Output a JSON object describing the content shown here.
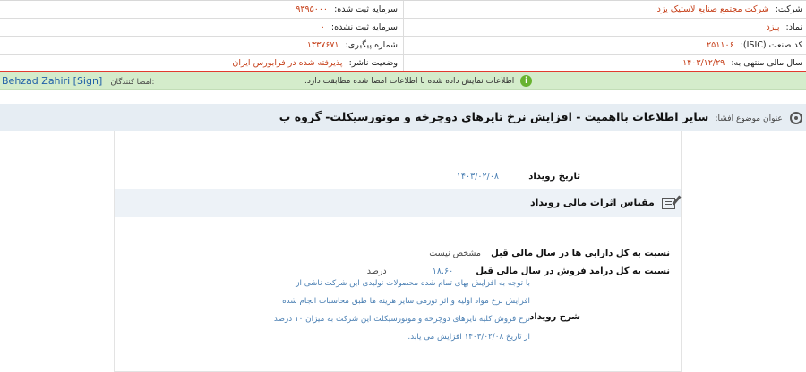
{
  "company_info": {
    "company_label": "شرکت:",
    "company_value": "شرکت مجتمع صنایع لاستیک یزد",
    "symbol_label": "نماد:",
    "symbol_value": "پیزد",
    "isic_label": "کد صنعت (ISIC):",
    "isic_value": "۲۵۱۱۰۶",
    "fiscal_year_label": "سال مالی منتهی به:",
    "fiscal_year_value": "۱۴۰۳/۱۲/۲۹",
    "registered_capital_label": "سرمایه ثبت شده:",
    "registered_capital_value": "۹۳۹۵۰۰۰",
    "unregistered_capital_label": "سرمایه ثبت نشده:",
    "unregistered_capital_value": "۰",
    "tracking_label": "شماره پیگیری:",
    "tracking_value": "۱۳۳۷۶۷۱",
    "publisher_status_label": "وضعیت ناشر:",
    "publisher_status_value": "پذیرفته شده در فرابورس ایران"
  },
  "signers": {
    "label": "امضا کنندگان:",
    "name": "Behzad Zahiri [Sign]",
    "notice": "اطلاعات نمایش داده شده با اطلاعات امضا شده مطابقت دارد."
  },
  "subject": {
    "label": "عنوان موضوع افشا:",
    "title": "سایر اطلاعات بااهمیت - افزایش نرخ تایرهای دوچرخه و موتورسیکلت- گروه ب"
  },
  "event": {
    "date_label": "تاریخ رویداد",
    "date_value": "۱۴۰۳/۰۲/۰۸",
    "section_title": "مقیاس اثرات مالی رویداد",
    "assets_ratio_label": "نسبت به کل دارایی ها در سال مالی قبل",
    "assets_ratio_value": "مشخص نیست",
    "sales_ratio_label": "نسبت به کل درامد فروش در سال مالی قبل",
    "sales_ratio_value": "۱۸.۶۰",
    "sales_ratio_unit": "درصد",
    "description_label": "شرح رویداد",
    "description_text": "با توجه به افزایش بهای تمام شده محصولات تولیدی این شرکت ناشی از افزایش نرخ مواد اولیه و اثر تورمی سایر هزینه ها طبق محاسبات انجام شده نرخ فروش کلیه تایرهای دوچرخه و موتورسیکلت این شرکت به میزان ۱۰ درصد از تاریخ ۱۴۰۳/۰۲/۰۸ افزایش می یابد."
  },
  "colors": {
    "accent_value": "#c6401a",
    "signer_bar": "#d4eccb",
    "signer_border": "#e23a2f",
    "link_blue": "#1f5fa8",
    "subject_bg": "#e6edf3"
  },
  "icons": [
    "info-icon",
    "target-icon",
    "edit-icon"
  ]
}
